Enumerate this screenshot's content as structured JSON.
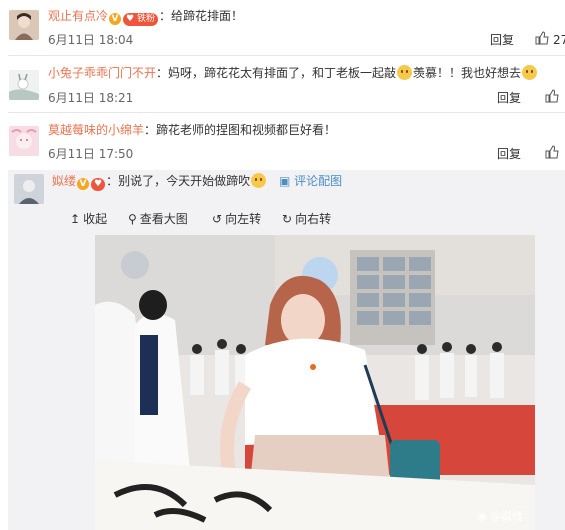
{
  "comments": [
    {
      "username": "观止有点冷",
      "fan_badge": "铁粉",
      "text": "：给蹄花排面！",
      "time": "6月11日 18:04",
      "reply_label": "回复",
      "likes": "27"
    },
    {
      "username": "小兔子乖乖门门不开",
      "text_a": "：妈呀，蹄花花太有排面了，和丁老板一起敲",
      "text_b": "羡慕！！我也好想去",
      "time": "6月11日 18:21",
      "reply_label": "回复"
    },
    {
      "username": "莫越莓味的小绵羊",
      "text": "：蹄花老师的捏图和视频都巨好看！",
      "time": "6月11日 17:50",
      "reply_label": "回复"
    }
  ],
  "nested_reply": {
    "username": "姒缕",
    "text": "：别说了，今天开始做蹄吹",
    "view_image_label": "评论配图"
  },
  "image_toolbar": {
    "collapse": "收起",
    "view_large": "查看大图",
    "rotate_left": "向左转",
    "rotate_right": "向右转"
  },
  "watermark": "@姒缕",
  "colors": {
    "username": "#eb7350",
    "link": "#4a8ec2",
    "divider": "#e6e6e6"
  }
}
